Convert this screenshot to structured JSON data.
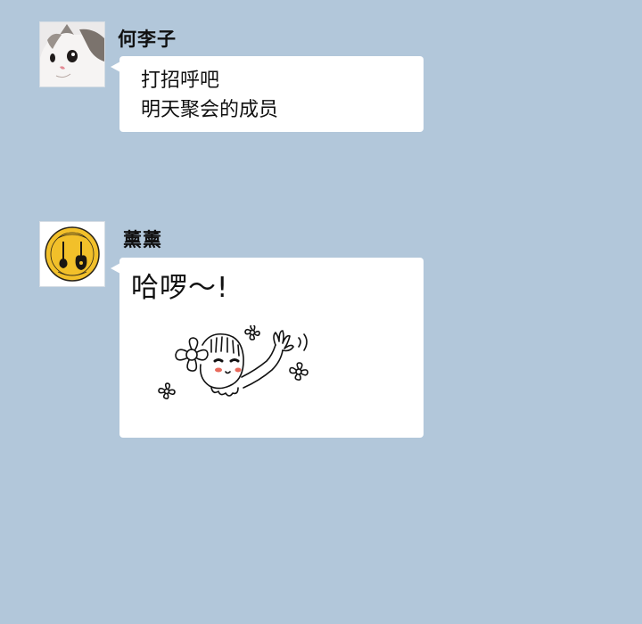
{
  "chat": {
    "messages": [
      {
        "sender": "何李子",
        "avatar_icon": "cat-avatar-icon",
        "lines": [
          "打招呼吧",
          "明天聚会的成员"
        ]
      },
      {
        "sender": "薰薰",
        "avatar_icon": "guitar-concert-logo-icon",
        "text": "哈啰～!",
        "sticker": "waving-girl-sticker"
      }
    ]
  },
  "colors": {
    "background": "#b2c7da",
    "bubble": "#ffffff",
    "logo_yellow": "#f2c02a"
  }
}
